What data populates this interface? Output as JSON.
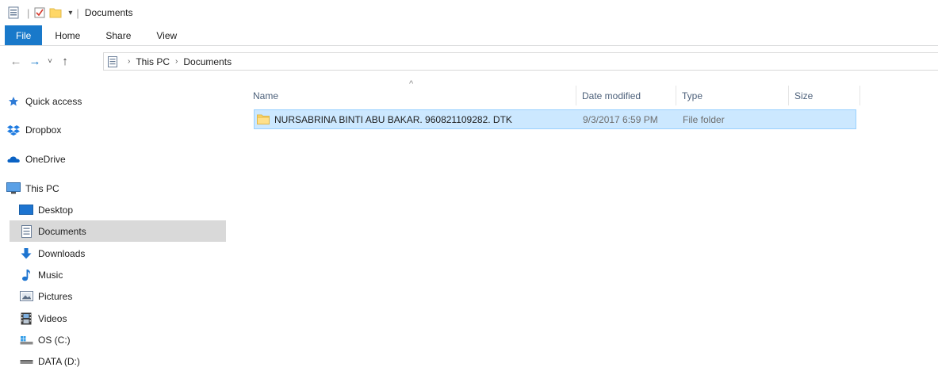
{
  "window": {
    "title": "Documents",
    "qa_dropdown_glyph": "▾"
  },
  "ribbon": {
    "tabs": [
      "File",
      "Home",
      "Share",
      "View"
    ]
  },
  "nav": {
    "back_glyph": "←",
    "forward_glyph": "→",
    "recent_glyph": "˅",
    "up_glyph": "↑",
    "breadcrumbs": [
      "This PC",
      "Documents"
    ],
    "breadcrumb_sep": "›"
  },
  "sidebar": {
    "items": [
      {
        "label": "Quick access",
        "icon": "star-icon"
      },
      {
        "label": "Dropbox",
        "icon": "dropbox-icon"
      },
      {
        "label": "OneDrive",
        "icon": "onedrive-icon"
      },
      {
        "label": "This PC",
        "icon": "computer-icon"
      },
      {
        "label": "Desktop",
        "icon": "desktop-icon"
      },
      {
        "label": "Documents",
        "icon": "documents-icon",
        "selected": true
      },
      {
        "label": "Downloads",
        "icon": "download-icon"
      },
      {
        "label": "Music",
        "icon": "music-icon"
      },
      {
        "label": "Pictures",
        "icon": "pictures-icon"
      },
      {
        "label": "Videos",
        "icon": "videos-icon"
      },
      {
        "label": "OS (C:)",
        "icon": "drive-c-icon"
      },
      {
        "label": "DATA (D:)",
        "icon": "drive-d-icon"
      }
    ]
  },
  "table": {
    "sort_glyph": "^",
    "columns": [
      "Name",
      "Date modified",
      "Type",
      "Size"
    ],
    "rows": [
      {
        "name": "NURSABRINA BINTI ABU BAKAR. 960821109282. DTK",
        "date_modified": "9/3/2017 6:59 PM",
        "type": "File folder",
        "size": "",
        "selected": true
      }
    ]
  },
  "colors": {
    "accent": "#1979ca",
    "selection_bg": "#cce8ff",
    "selection_border": "#99d1ff",
    "nav_selected": "#d9d9d9",
    "folder": "#ffd766"
  }
}
